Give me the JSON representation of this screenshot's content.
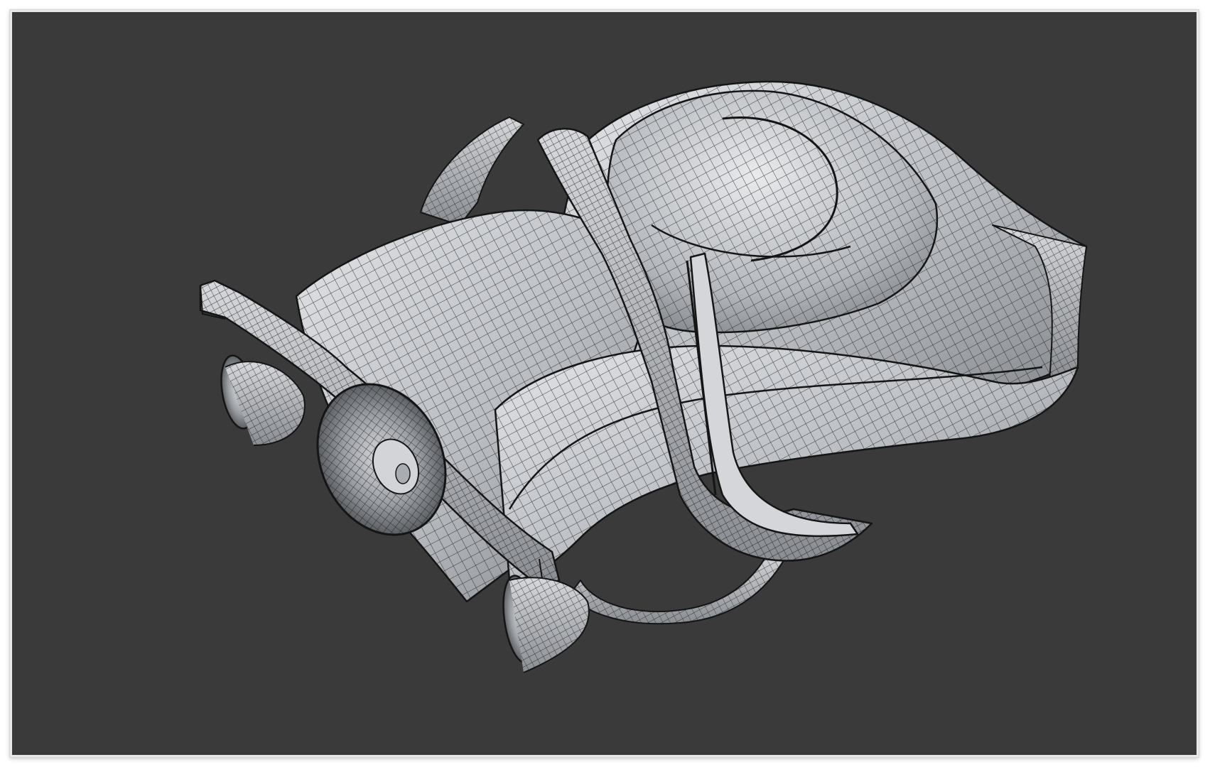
{
  "viewport": {
    "background": "#3a3a3a",
    "model": {
      "surface_color": "#bfc2c6",
      "wire_color": "#151515",
      "shading": "smooth-shaded-with-wireframe"
    }
  }
}
